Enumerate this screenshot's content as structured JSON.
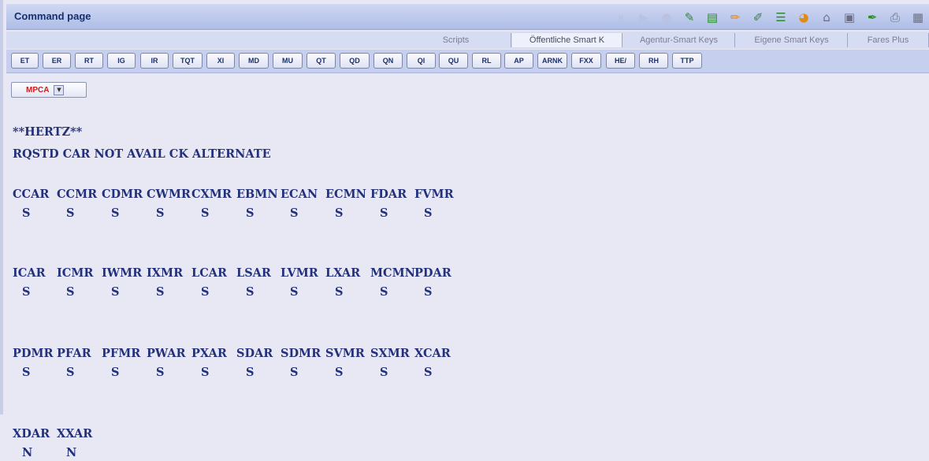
{
  "window": {
    "title": "Command page"
  },
  "toolbar_icons": [
    {
      "name": "pause-icon",
      "glyph": "⏸",
      "dim": true
    },
    {
      "name": "play-icon",
      "glyph": "▶",
      "dim": true
    },
    {
      "name": "stop-icon",
      "glyph": "●",
      "dim": true
    },
    {
      "name": "magic-icon",
      "glyph": "✎",
      "color": "green"
    },
    {
      "name": "book-icon",
      "glyph": "▤",
      "color": "green"
    },
    {
      "name": "pencil-icon",
      "glyph": "✏",
      "color": "orange"
    },
    {
      "name": "brush-icon",
      "glyph": "✐",
      "color": "green"
    },
    {
      "name": "list-icon",
      "glyph": "☰",
      "color": "green"
    },
    {
      "name": "globe-icon",
      "glyph": "◕",
      "color": "orange"
    },
    {
      "name": "text-icon",
      "glyph": "⌂",
      "color": "gray"
    },
    {
      "name": "window-icon",
      "glyph": "▣",
      "color": "gray"
    },
    {
      "name": "pen-icon",
      "glyph": "✒",
      "color": "green"
    },
    {
      "name": "printer-icon",
      "glyph": "⎙",
      "color": "gray"
    },
    {
      "name": "calculator-icon",
      "glyph": "▦",
      "color": "gray"
    }
  ],
  "tabs": [
    {
      "label": "Scripts",
      "active": false
    },
    {
      "label": "Öffentliche Smart K",
      "active": true
    },
    {
      "label": "Agentur-Smart Keys",
      "active": false
    },
    {
      "label": "Eigene Smart Keys",
      "active": false
    },
    {
      "label": "Fares Plus",
      "active": false
    }
  ],
  "command_buttons": [
    "ET",
    "ER",
    "RT",
    "IG",
    "IR",
    "TQT",
    "XI",
    "MD",
    "MU",
    "QT",
    "QD",
    "QN",
    "QI",
    "QU",
    "RL",
    "AP",
    "ARNK",
    "FXX",
    "HE/",
    "RH",
    "TTP"
  ],
  "dropdown": {
    "selected": "MPCA"
  },
  "response": {
    "header_lines": [
      "**HERTZ**",
      "RQSTD CAR NOT AVAIL CK ALTERNATE"
    ],
    "blocks": [
      {
        "codes": [
          "CCAR",
          "CCMR",
          "CDMR",
          "CWMR",
          "CXMR",
          "EBMN",
          "ECAN",
          "ECMN",
          "FDAR",
          "FVMR"
        ],
        "status": [
          "S",
          "S",
          "S",
          "S",
          "S",
          "S",
          "S",
          "S",
          "S",
          "S"
        ]
      },
      {
        "codes": [
          "ICAR",
          "ICMR",
          "IWMR",
          "IXMR",
          "LCAR",
          "LSAR",
          "LVMR",
          "LXAR",
          "MCMN",
          "PDAR"
        ],
        "status": [
          "S",
          "S",
          "S",
          "S",
          "S",
          "S",
          "S",
          "S",
          "S",
          "S"
        ]
      },
      {
        "codes": [
          "PDMR",
          "PFAR",
          "PFMR",
          "PWAR",
          "PXAR",
          "SDAR",
          "SDMR",
          "SVMR",
          "SXMR",
          "XCAR"
        ],
        "status": [
          "S",
          "S",
          "S",
          "S",
          "S",
          "S",
          "S",
          "S",
          "S",
          "S"
        ]
      },
      {
        "codes": [
          "XDAR",
          "XXAR"
        ],
        "status": [
          "N",
          "N"
        ]
      }
    ]
  },
  "colors": {
    "accent": "#23307c",
    "titlebar": "#b8c6ec",
    "alert": "#c81e1e"
  }
}
